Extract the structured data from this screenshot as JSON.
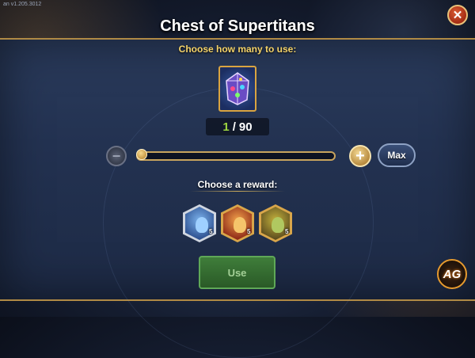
{
  "version": "an v1.205.3012",
  "dialog": {
    "title": "Chest of Supertitans",
    "subtitle": "Choose how many to use:",
    "item": {
      "icon": "chest-of-supertitans-icon"
    },
    "counter": {
      "current": "1",
      "separator": "/",
      "max": "90"
    },
    "slider": {
      "value": 1,
      "max": 90,
      "minus_icon": "minus-icon",
      "plus_icon": "plus-icon"
    },
    "max_label": "Max",
    "reward_label": "Choose a reward:",
    "rewards": [
      {
        "icon": "titan-blue-icon",
        "stars": "5"
      },
      {
        "icon": "titan-fire-icon",
        "stars": "5"
      },
      {
        "icon": "titan-earth-icon",
        "stars": "5"
      }
    ],
    "use_label": "Use",
    "close_icon": "close-icon"
  },
  "logo_text": "AG",
  "colors": {
    "accent_gold": "#d9a441",
    "counter_green": "#9ed640",
    "subtitle_yellow": "#f5d46a",
    "use_button_green": "#3f7d3a",
    "close_red": "#a32c14"
  }
}
